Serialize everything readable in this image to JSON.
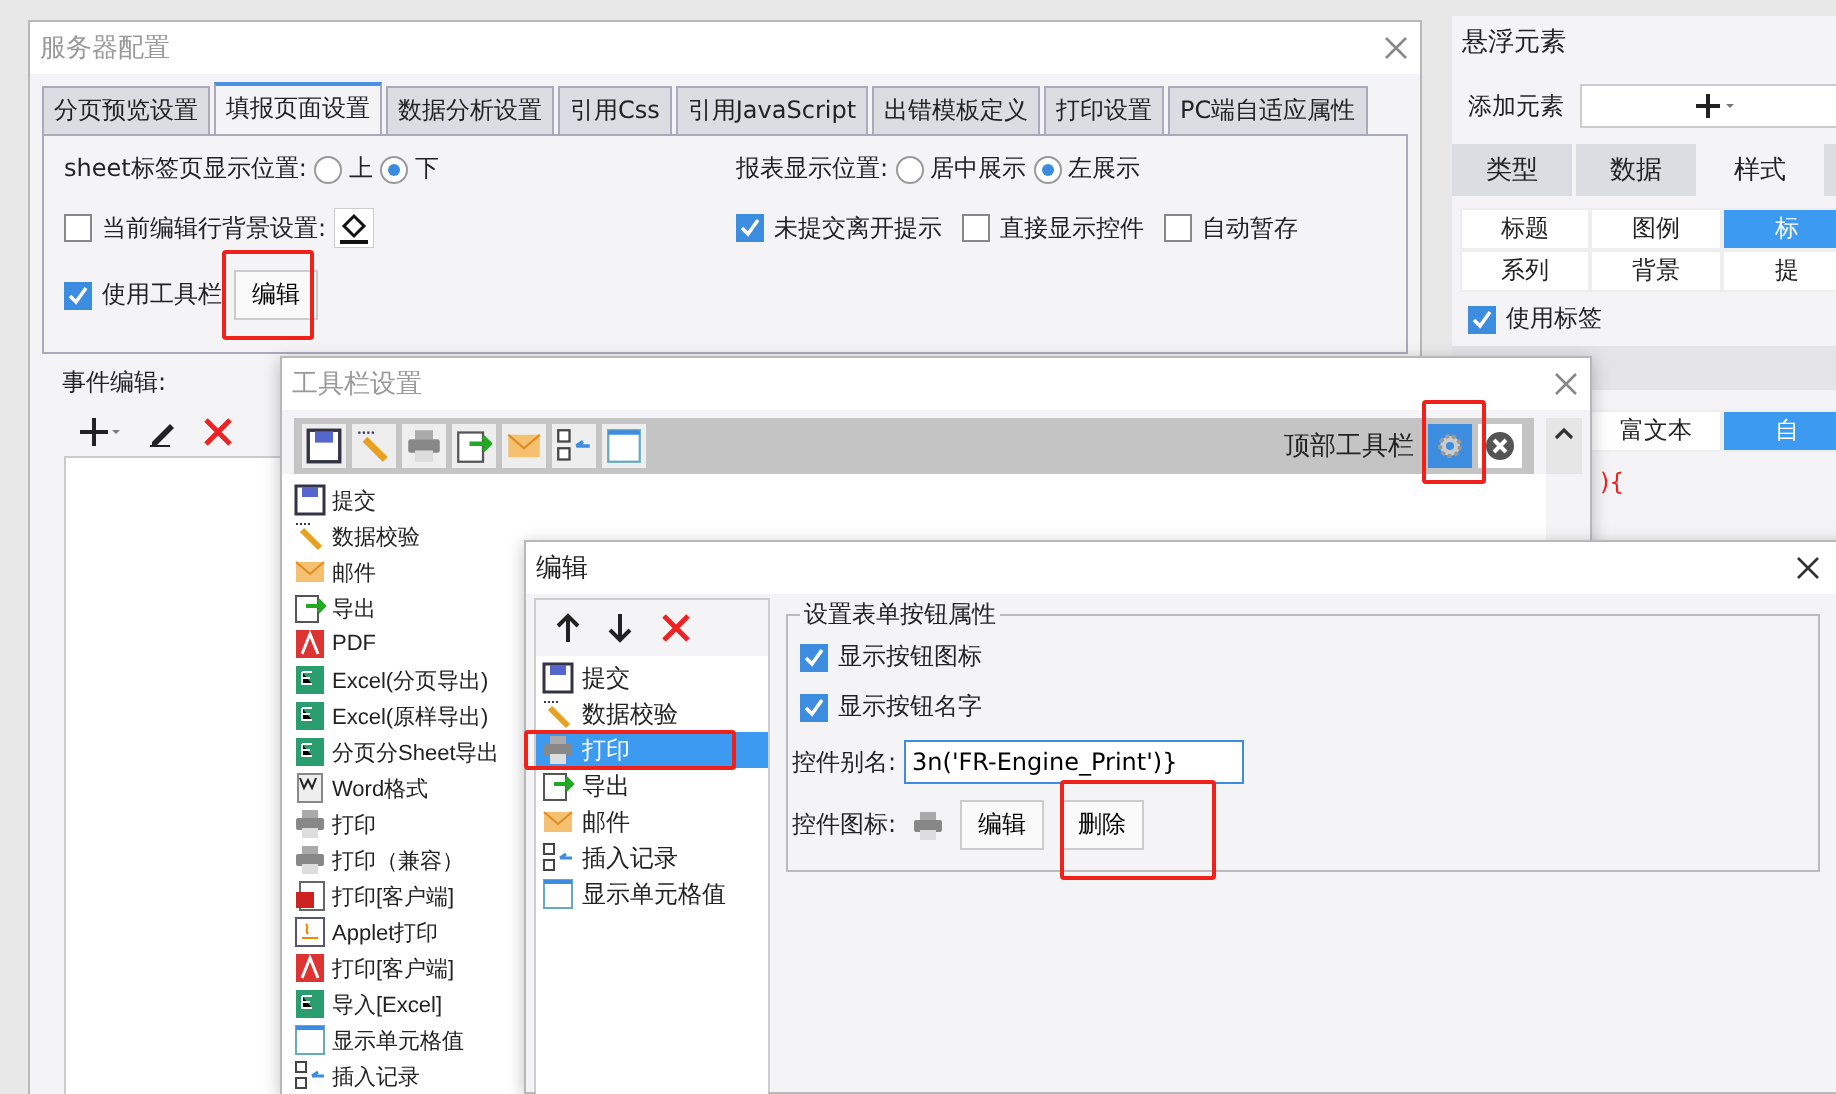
{
  "server_config": {
    "title": "服务器配置",
    "tabs": [
      {
        "label": "分页预览设置",
        "selected": false
      },
      {
        "label": "填报页面设置",
        "selected": true
      },
      {
        "label": "数据分析设置",
        "selected": false
      },
      {
        "label": "引用Css",
        "selected": false
      },
      {
        "label": "引用JavaScript",
        "selected": false
      },
      {
        "label": "出错模板定义",
        "selected": false
      },
      {
        "label": "打印设置",
        "selected": false
      },
      {
        "label": "PC端自适应属性",
        "selected": false
      }
    ],
    "sheet_position": {
      "label": "sheet标签页显示位置:",
      "options": [
        {
          "label": "上",
          "selected": false
        },
        {
          "label": "下",
          "selected": true
        }
      ]
    },
    "report_position": {
      "label": "报表显示位置:",
      "options": [
        {
          "label": "居中展示",
          "selected": false
        },
        {
          "label": "左展示",
          "selected": true
        }
      ]
    },
    "row_background": {
      "label": "当前编辑行背景设置:",
      "checked": false
    },
    "options": [
      {
        "label": "未提交离开提示",
        "checked": true
      },
      {
        "label": "直接显示控件",
        "checked": false
      },
      {
        "label": "自动暂存",
        "checked": false
      }
    ],
    "use_toolbar": {
      "label": "使用工具栏",
      "checked": true
    },
    "edit_button": "编辑",
    "event_label": "事件编辑:"
  },
  "float_panel": {
    "title": "悬浮元素",
    "add_label": "添加元素",
    "tabs": [
      {
        "label": "类型",
        "selected": false
      },
      {
        "label": "数据",
        "selected": false
      },
      {
        "label": "样式",
        "selected": true
      }
    ],
    "subtabs": [
      {
        "label": "标题",
        "selected": false
      },
      {
        "label": "图例",
        "selected": false
      },
      {
        "label": "标",
        "selected": true
      },
      {
        "label": "系列",
        "selected": false
      },
      {
        "label": "背景",
        "selected": false
      },
      {
        "label": "提",
        "selected": false
      }
    ],
    "use_label": {
      "label": "使用标签",
      "checked": true
    },
    "text_tabs": [
      {
        "label": "富文本",
        "selected": false
      },
      {
        "label": "自",
        "selected": true
      }
    ],
    "code_fragment": "){"
  },
  "toolbar_dialog": {
    "title": "工具栏设置",
    "toolbar_label": "顶部工具栏",
    "items": [
      {
        "label": "提交",
        "kind": "save"
      },
      {
        "label": "数据校验",
        "kind": "validate"
      },
      {
        "label": "邮件",
        "kind": "mail"
      },
      {
        "label": "导出",
        "kind": "export"
      },
      {
        "label": "PDF",
        "kind": "pdf"
      },
      {
        "label": "Excel(分页导出)",
        "kind": "excel"
      },
      {
        "label": "Excel(原样导出)",
        "kind": "excel"
      },
      {
        "label": "分页分Sheet导出",
        "kind": "excel"
      },
      {
        "label": "Word格式",
        "kind": "word"
      },
      {
        "label": "打印",
        "kind": "print"
      },
      {
        "label": "打印（兼容）",
        "kind": "print"
      },
      {
        "label": "打印[客户端]",
        "kind": "flash"
      },
      {
        "label": "Applet打印",
        "kind": "applet"
      },
      {
        "label": "打印[客户端]",
        "kind": "pdf"
      },
      {
        "label": "导入[Excel]",
        "kind": "excel"
      },
      {
        "label": "显示单元格值",
        "kind": "cell"
      },
      {
        "label": "插入记录",
        "kind": "insert"
      }
    ]
  },
  "edit_dialog": {
    "title": "编辑",
    "items": [
      {
        "label": "提交",
        "kind": "save",
        "selected": false
      },
      {
        "label": "数据校验",
        "kind": "validate",
        "selected": false
      },
      {
        "label": "打印",
        "kind": "print",
        "selected": true
      },
      {
        "label": "导出",
        "kind": "export",
        "selected": false
      },
      {
        "label": "邮件",
        "kind": "mail",
        "selected": false
      },
      {
        "label": "插入记录",
        "kind": "insert",
        "selected": false
      },
      {
        "label": "显示单元格值",
        "kind": "cell",
        "selected": false
      }
    ],
    "group_title": "设置表单按钮属性",
    "show_icon": {
      "label": "显示按钮图标",
      "checked": true
    },
    "show_name": {
      "label": "显示按钮名字",
      "checked": true
    },
    "alias_label": "控件别名:",
    "alias_value": "3n('FR-Engine_Print')}",
    "icon_label": "控件图标:",
    "edit_button": "编辑",
    "delete_button": "删除"
  }
}
